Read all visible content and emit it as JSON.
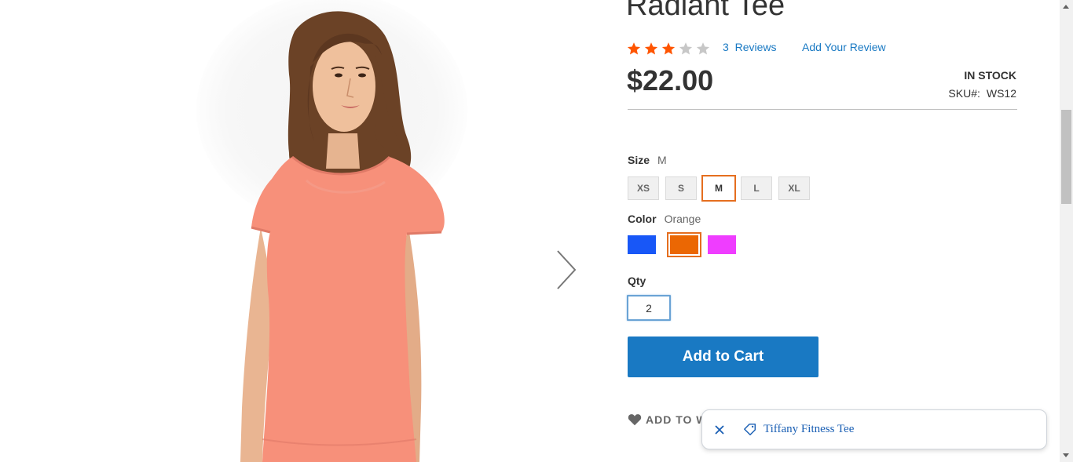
{
  "product": {
    "title": "Radiant Tee",
    "rating_stars": 3,
    "rating_max": 5,
    "reviews_count": "3",
    "reviews_word": "Reviews",
    "add_review": "Add Your Review",
    "price": "$22.00",
    "stock": "IN STOCK",
    "sku_label": "SKU#:",
    "sku_value": "WS12"
  },
  "options": {
    "size": {
      "label": "Size",
      "selected": "M",
      "values": [
        "XS",
        "S",
        "M",
        "L",
        "XL"
      ]
    },
    "color": {
      "label": "Color",
      "selected": "Orange",
      "swatches": [
        {
          "name": "blue",
          "color": "#1857f7"
        },
        {
          "name": "orange",
          "color": "#eb6703"
        },
        {
          "name": "purple",
          "color": "#ef3dff"
        }
      ]
    },
    "qty": {
      "label": "Qty",
      "value": "2"
    }
  },
  "actions": {
    "add_to_cart": "Add to Cart",
    "wishlist": "ADD TO W"
  },
  "toast": {
    "link_text": "Tiffany Fitness Tee"
  },
  "colors": {
    "accent": "#1979c3",
    "selected_border": "#e56e1f",
    "star_filled": "#ff5501",
    "star_empty": "#c7c7c7"
  },
  "icons": {
    "next": "chevron-right-icon",
    "wishlist": "heart-icon",
    "toast_close": "close-icon",
    "toast_tag": "tag-icon"
  }
}
